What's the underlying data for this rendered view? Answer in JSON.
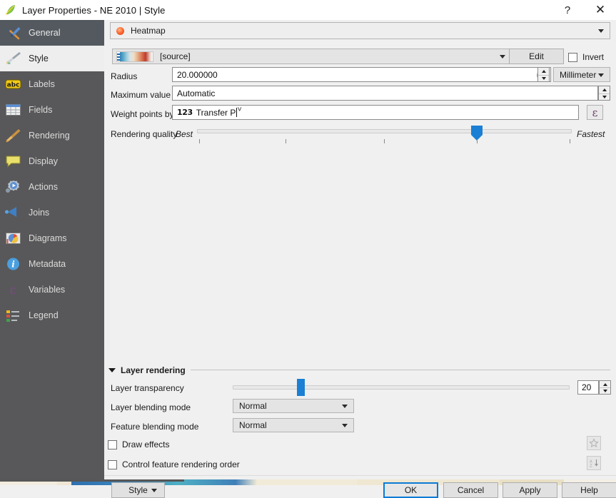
{
  "window": {
    "title": "Layer Properties - NE 2010 | Style",
    "app_icon": "qgis-leaf-icon",
    "help_button": "?",
    "close_button": "✕"
  },
  "sidebar": {
    "items": [
      {
        "label": "General",
        "icon": "hammer-wrench-icon",
        "state": "selected-dark"
      },
      {
        "label": "Style",
        "icon": "paintbrush-icon",
        "state": "selected-light"
      },
      {
        "label": "Labels",
        "icon": "abc-label-icon",
        "state": "normal"
      },
      {
        "label": "Fields",
        "icon": "table-grid-icon",
        "state": "normal"
      },
      {
        "label": "Rendering",
        "icon": "broom-icon",
        "state": "normal"
      },
      {
        "label": "Display",
        "icon": "speech-bubble-icon",
        "state": "normal"
      },
      {
        "label": "Actions",
        "icon": "gear-play-icon",
        "state": "normal"
      },
      {
        "label": "Joins",
        "icon": "blue-arrow-icon",
        "state": "normal"
      },
      {
        "label": "Diagrams",
        "icon": "pie-chart-icon",
        "state": "normal"
      },
      {
        "label": "Metadata",
        "icon": "info-circle-icon",
        "state": "normal"
      },
      {
        "label": "Variables",
        "icon": "epsilon-icon",
        "state": "normal"
      },
      {
        "label": "Legend",
        "icon": "legend-list-icon",
        "state": "normal"
      }
    ]
  },
  "style_panel": {
    "renderer": {
      "value": "Heatmap",
      "icon": "heatmap-blob-icon"
    },
    "color_ramp": {
      "value": "[source]",
      "preview_icon": "color-ramp-gradient",
      "edit_label": "Edit",
      "invert_label": "Invert",
      "invert_checked": false
    },
    "radius": {
      "label": "Radius",
      "value": "20.000000",
      "units": "Millimeter",
      "clear_icon": "✕"
    },
    "maximum_value": {
      "label": "Maximum value",
      "value": "Automatic"
    },
    "weight_points_by": {
      "label": "Weight points by",
      "badge": "123",
      "value": "Transfer P",
      "expression_button": "ε"
    },
    "rendering_quality": {
      "label": "Rendering quality",
      "min_label": "Best",
      "max_label": "Fastest",
      "value_percent": 75
    }
  },
  "layer_rendering": {
    "title": "Layer rendering",
    "expanded": true,
    "transparency": {
      "label": "Layer transparency",
      "value": "20",
      "value_percent": 20
    },
    "layer_blending_mode": {
      "label": "Layer blending mode",
      "value": "Normal"
    },
    "feature_blending_mode": {
      "label": "Feature blending mode",
      "value": "Normal"
    },
    "draw_effects": {
      "label": "Draw effects",
      "checked": false,
      "button_icon": "star-effects-icon"
    },
    "control_feature_rendering_order": {
      "label": "Control feature rendering order",
      "checked": false,
      "button_icon": "sort-az-icon"
    }
  },
  "buttons": {
    "style_menu": "Style",
    "ok": "OK",
    "cancel": "Cancel",
    "apply": "Apply",
    "help": "Help"
  },
  "colors": {
    "accent_blue": "#1b7fd4",
    "focus_blue": "#0a7bd6",
    "sidebar_bg": "#58585a",
    "panel_bg": "#f0f0f0",
    "selected_item_bg": "#eeeeee"
  }
}
